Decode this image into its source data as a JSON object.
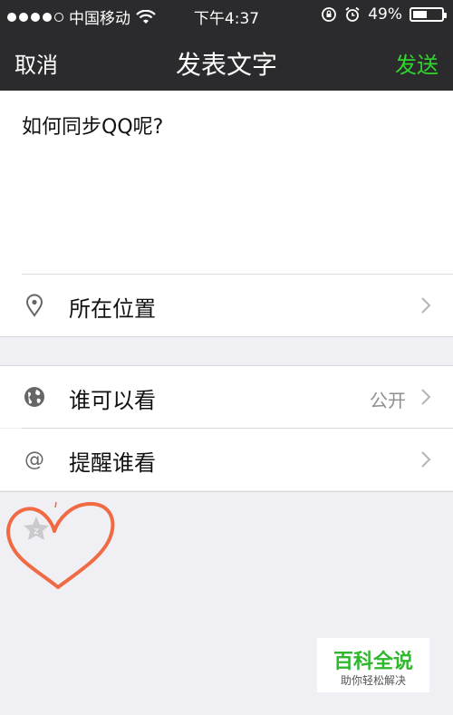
{
  "status_bar": {
    "carrier": "中国移动",
    "time": "下午4:37",
    "battery_percent": "49%",
    "battery_level": 0.49
  },
  "nav": {
    "cancel_label": "取消",
    "title": "发表文字",
    "send_label": "发送",
    "send_color": "#2fd42c"
  },
  "compose": {
    "text": "如何同步QQ呢?"
  },
  "rows": {
    "location": {
      "label": "所在位置",
      "icon": "location-pin-icon"
    },
    "visibility": {
      "label": "谁可以看",
      "value": "公开",
      "icon": "globe-icon"
    },
    "remind": {
      "label": "提醒谁看",
      "icon": "at-icon"
    }
  },
  "watermark": {
    "title": "百科全说",
    "subtitle": "助你轻松解决"
  }
}
